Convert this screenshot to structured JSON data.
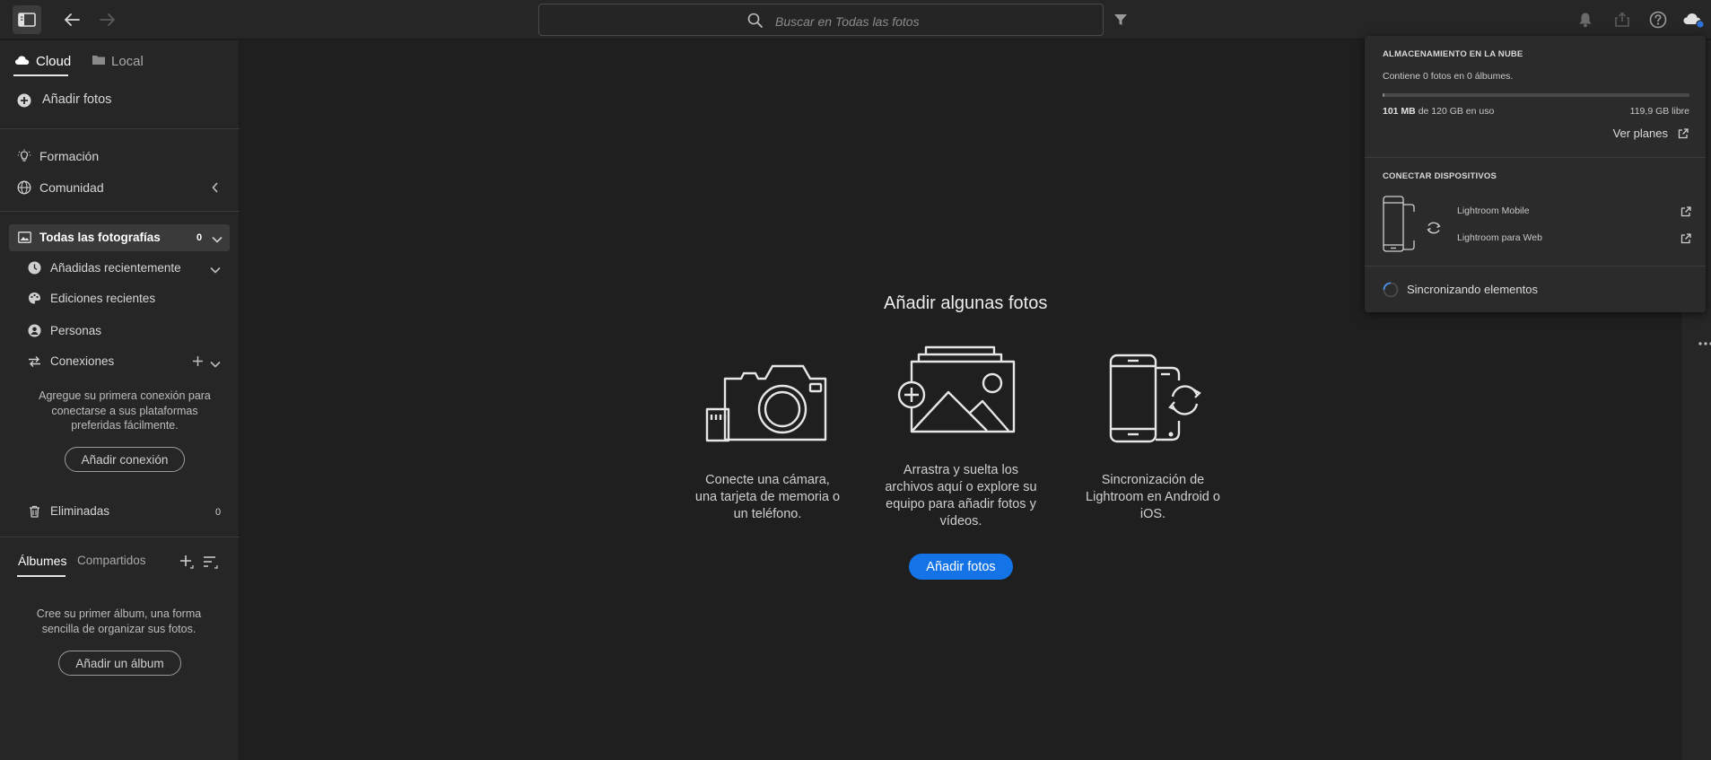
{
  "header": {
    "search_placeholder": "Buscar en Todas las fotos",
    "icons": [
      "panel-toggle-icon",
      "back-arrow-icon",
      "forward-arrow-icon",
      "search-icon",
      "filter-icon",
      "bell-icon",
      "share-icon",
      "help-icon",
      "cloud-icon"
    ]
  },
  "sidebar": {
    "tabs": {
      "cloud": "Cloud",
      "local": "Local"
    },
    "add_photos": "Añadir fotos",
    "learn": "Formación",
    "community": "Comunidad",
    "all_photos": {
      "label": "Todas las fotografías",
      "count": "0"
    },
    "recently_added": "Añadidas recientemente",
    "recent_edits": "Ediciones recientes",
    "people": "Personas",
    "connections": "Conexiones",
    "connections_help": "Agregue su primera conexión para conectarse a sus plataformas preferidas fácilmente.",
    "add_connection": "Añadir conexión",
    "deleted": {
      "label": "Eliminadas",
      "count": "0"
    },
    "album_tabs": {
      "albums": "Álbumes",
      "shared": "Compartidos"
    },
    "albums_help": "Cree su primer álbum, una forma sencilla de organizar sus fotos.",
    "add_album": "Añadir un álbum"
  },
  "main": {
    "title": "Añadir algunas fotos",
    "options": [
      {
        "caption": "Conecte una cámara, una tarjeta de memoria o un teléfono.",
        "icon": "camera-icon"
      },
      {
        "caption": "Arrastra y suelta los archivos aquí o explore su equipo para añadir fotos y vídeos.",
        "icon": "add-image-icon"
      },
      {
        "caption": "Sincronización de Lightroom en Android o iOS.",
        "icon": "devices-sync-icon"
      }
    ],
    "add_button": "Añadir fotos"
  },
  "cloud_popover": {
    "storage_heading": "ALMACENAMIENTO EN LA NUBE",
    "contains": "Contiene 0 fotos en 0 álbumes.",
    "usage_fraction": 0.001,
    "used_amount": "101 MB",
    "used_rest": "de 120 GB en uso",
    "free": "119,9 GB libre",
    "view_plans": "Ver planes",
    "devices_heading": "CONECTAR DISPOSITIVOS",
    "mobile": "Lightroom Mobile",
    "web": "Lightroom para Web",
    "syncing": "Sincronizando elementos"
  },
  "colors": {
    "accent": "#1473e6",
    "background": "#1f1f1f",
    "panel": "#262626"
  }
}
